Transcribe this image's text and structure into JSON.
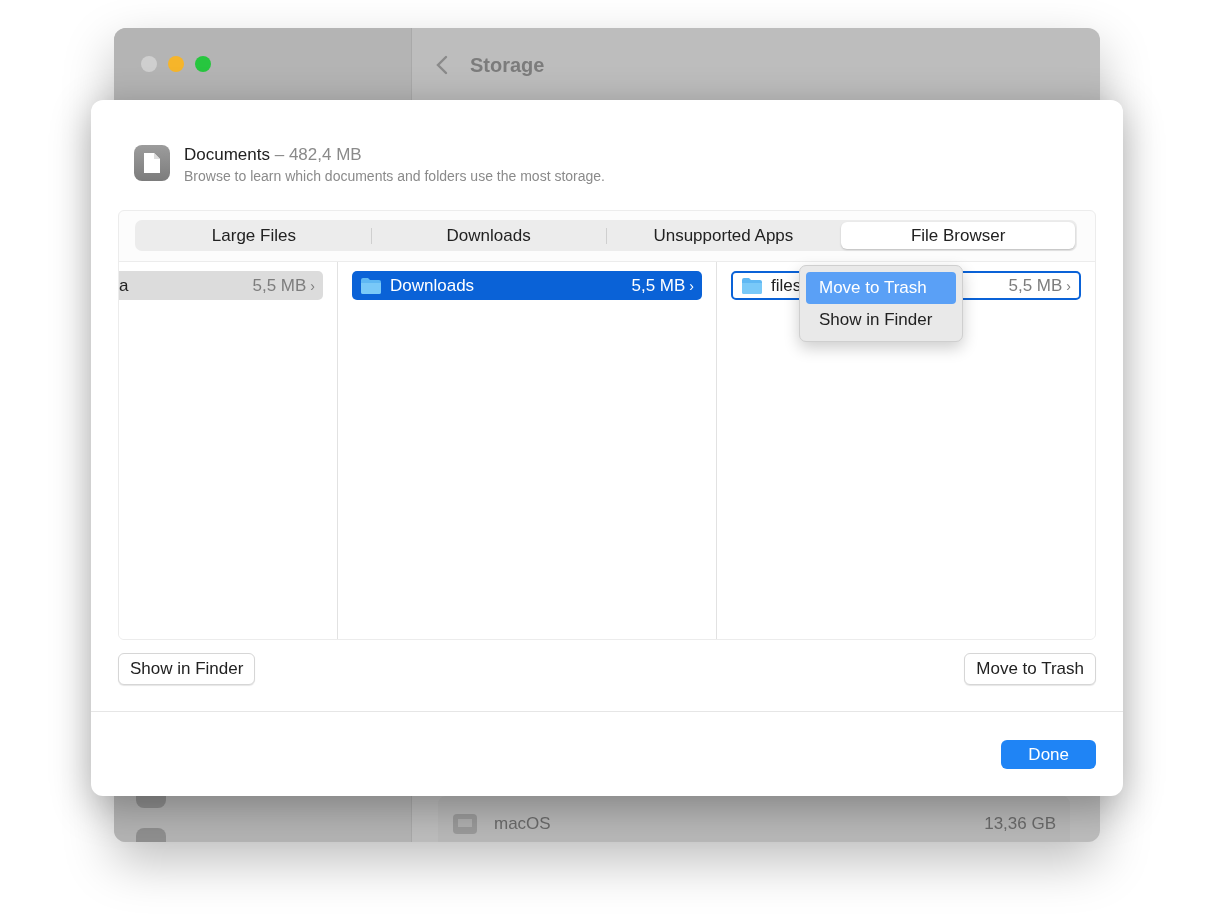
{
  "background_window": {
    "title": "Storage",
    "traffic_lights": [
      {
        "color": "#cfcfcf"
      },
      {
        "color": "#f6b52a"
      },
      {
        "color": "#27c63f"
      }
    ],
    "rows": [
      {
        "name": "macOS",
        "size": "13,36 GB"
      }
    ]
  },
  "sheet": {
    "title": "Documents",
    "title_detail": "– 482,4 MB",
    "subtitle": "Browse to learn which documents and folders use the most storage.",
    "tabs": [
      {
        "label": "Large Files",
        "selected": false
      },
      {
        "label": "Downloads",
        "selected": false
      },
      {
        "label": "Unsupported Apps",
        "selected": false
      },
      {
        "label": "File Browser",
        "selected": true
      }
    ],
    "columns": [
      {
        "rows": [
          {
            "name": "a",
            "size": "5,5 MB",
            "chevron": "›",
            "kind": "dimmed",
            "folder_icon": false
          }
        ]
      },
      {
        "rows": [
          {
            "name": "Downloads",
            "size": "5,5 MB",
            "chevron": "›",
            "kind": "selected",
            "folder_icon": true
          }
        ]
      },
      {
        "rows": [
          {
            "name": "files",
            "size": "5,5 MB",
            "chevron": "›",
            "kind": "focused",
            "folder_icon": true
          }
        ]
      }
    ],
    "context_menu": [
      {
        "label": "Move to Trash",
        "selected": true
      },
      {
        "label": "Show in Finder",
        "selected": false
      }
    ],
    "left_button": "Show in Finder",
    "right_button": "Move to Trash",
    "done_button": "Done"
  }
}
